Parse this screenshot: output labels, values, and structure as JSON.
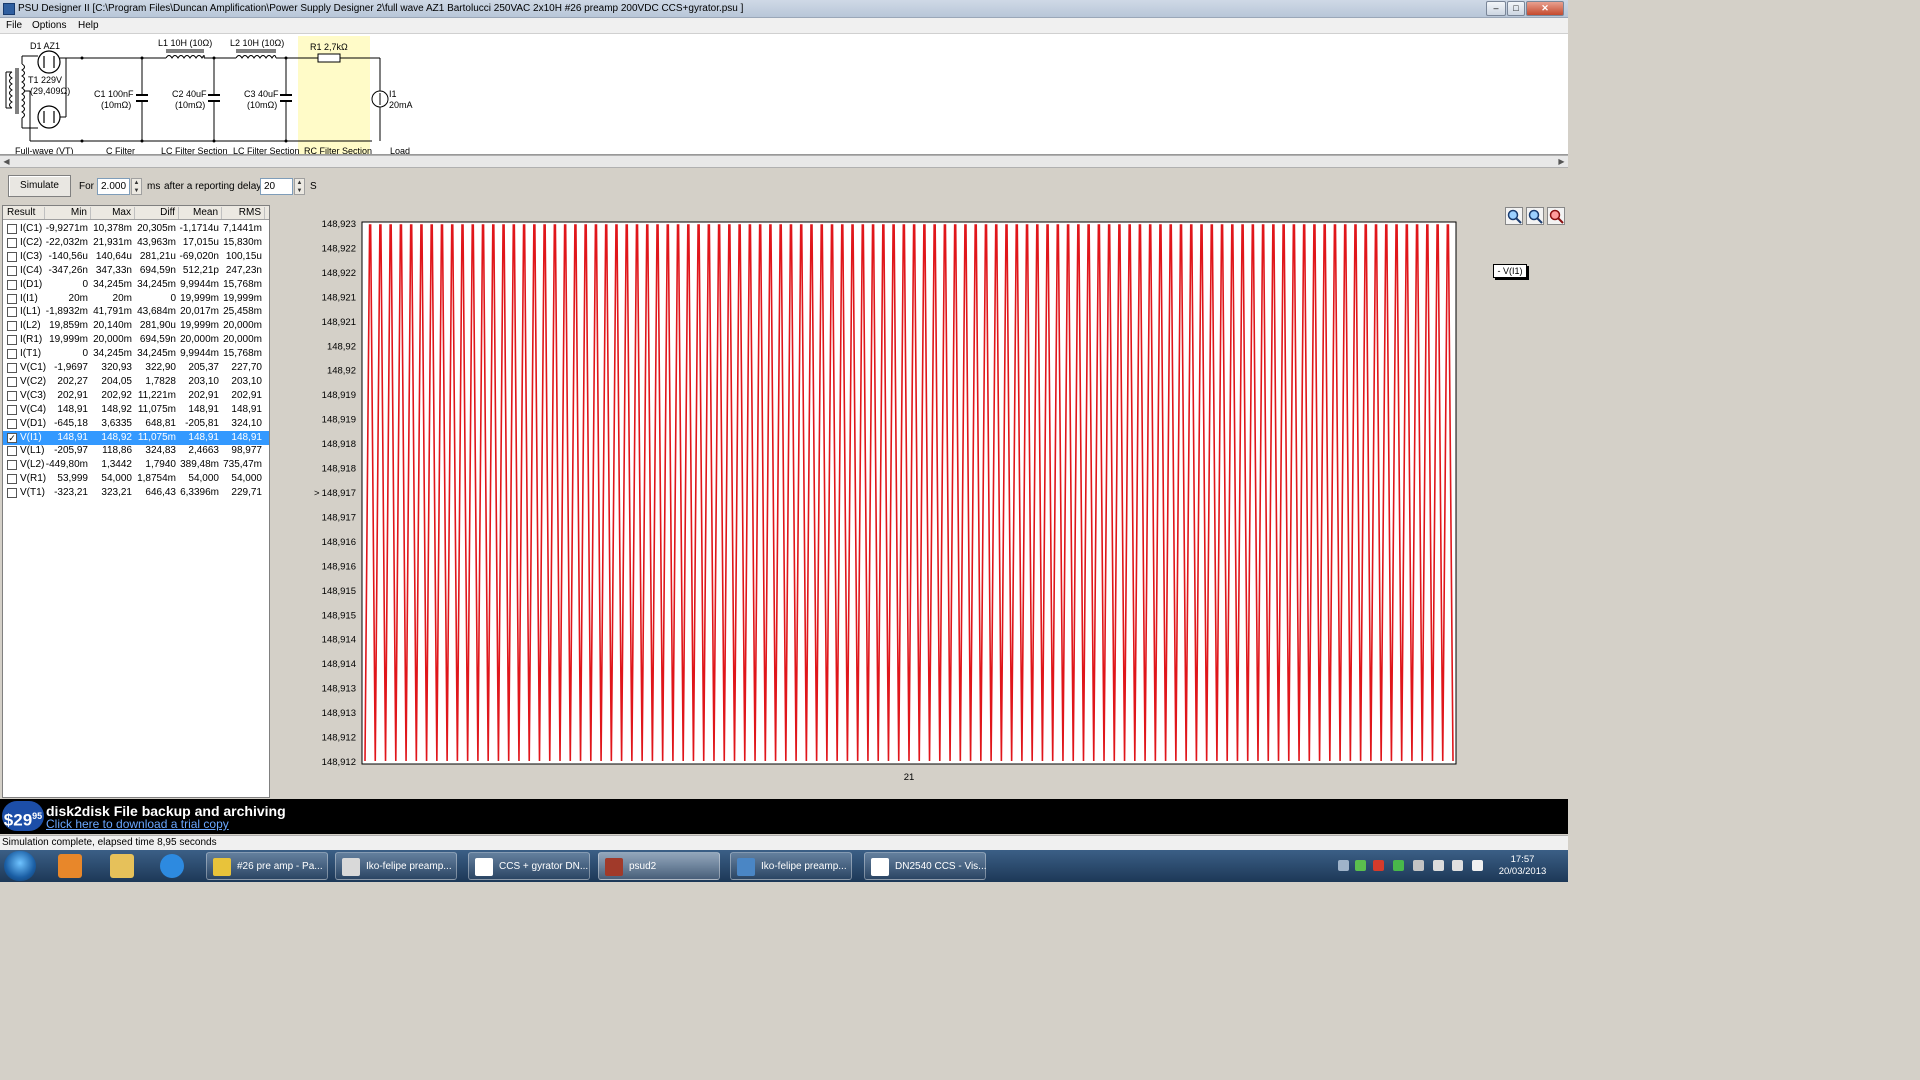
{
  "window": {
    "title": "PSU Designer II  [C:\\Program Files\\Duncan Amplification\\Power Supply Designer 2\\full wave AZ1 Bartolucci 250VAC 2x10H #26 preamp 200VDC CCS+gyrator.psu ]",
    "minimize": "–",
    "maximize": "□",
    "close": "✕"
  },
  "menu": [
    "File",
    "Options",
    "Help"
  ],
  "schematic": {
    "rectifier_label": "D1  AZ1",
    "transformer_label_1": "T1 229V",
    "transformer_label_2": "(29,409Ω)",
    "c1_label_1": "C1 100nF",
    "c1_label_2": "(10mΩ)",
    "l1_label": "L1 10H (10Ω)",
    "c2_label_1": "C2 40uF",
    "c2_label_2": "(10mΩ)",
    "l2_label": "L2 10H (10Ω)",
    "c3_label_1": "C3 40uF",
    "c3_label_2": "(10mΩ)",
    "r1_label": "R1 2,7kΩ",
    "load_label_1": "I1",
    "load_label_2": "20mA",
    "sections": [
      "Full-wave (VT)",
      "C Filter",
      "LC Filter Section",
      "LC Filter Section",
      "RC Filter Section",
      "Load"
    ]
  },
  "simulate": {
    "button": "Simulate",
    "for_label": "For",
    "duration": "2.000",
    "ms_label": "ms",
    "delay_label": "after a reporting delay of",
    "delay": "20",
    "s_label": "S"
  },
  "results": {
    "headers": [
      "Result",
      "Min",
      "Max",
      "Diff",
      "Mean",
      "RMS"
    ],
    "rows": [
      {
        "name": "I(C1)",
        "min": "-9,9271m",
        "max": "10,378m",
        "diff": "20,305m",
        "mean": "-1,1714u",
        "rms": "7,1441m",
        "checked": false
      },
      {
        "name": "I(C2)",
        "min": "-22,032m",
        "max": "21,931m",
        "diff": "43,963m",
        "mean": "17,015u",
        "rms": "15,830m",
        "checked": false
      },
      {
        "name": "I(C3)",
        "min": "-140,56u",
        "max": "140,64u",
        "diff": "281,21u",
        "mean": "-69,020n",
        "rms": "100,15u",
        "checked": false
      },
      {
        "name": "I(C4)",
        "min": "-347,26n",
        "max": "347,33n",
        "diff": "694,59n",
        "mean": "512,21p",
        "rms": "247,23n",
        "checked": false
      },
      {
        "name": "I(D1)",
        "min": "0",
        "max": "34,245m",
        "diff": "34,245m",
        "mean": "9,9944m",
        "rms": "15,768m",
        "checked": false
      },
      {
        "name": "I(I1)",
        "min": "20m",
        "max": "20m",
        "diff": "0",
        "mean": "19,999m",
        "rms": "19,999m",
        "checked": false
      },
      {
        "name": "I(L1)",
        "min": "-1,8932m",
        "max": "41,791m",
        "diff": "43,684m",
        "mean": "20,017m",
        "rms": "25,458m",
        "checked": false
      },
      {
        "name": "I(L2)",
        "min": "19,859m",
        "max": "20,140m",
        "diff": "281,90u",
        "mean": "19,999m",
        "rms": "20,000m",
        "checked": false
      },
      {
        "name": "I(R1)",
        "min": "19,999m",
        "max": "20,000m",
        "diff": "694,59n",
        "mean": "20,000m",
        "rms": "20,000m",
        "checked": false
      },
      {
        "name": "I(T1)",
        "min": "0",
        "max": "34,245m",
        "diff": "34,245m",
        "mean": "9,9944m",
        "rms": "15,768m",
        "checked": false
      },
      {
        "name": "V(C1)",
        "min": "-1,9697",
        "max": "320,93",
        "diff": "322,90",
        "mean": "205,37",
        "rms": "227,70",
        "checked": false
      },
      {
        "name": "V(C2)",
        "min": "202,27",
        "max": "204,05",
        "diff": "1,7828",
        "mean": "203,10",
        "rms": "203,10",
        "checked": false
      },
      {
        "name": "V(C3)",
        "min": "202,91",
        "max": "202,92",
        "diff": "11,221m",
        "mean": "202,91",
        "rms": "202,91",
        "checked": false
      },
      {
        "name": "V(C4)",
        "min": "148,91",
        "max": "148,92",
        "diff": "11,075m",
        "mean": "148,91",
        "rms": "148,91",
        "checked": false
      },
      {
        "name": "V(D1)",
        "min": "-645,18",
        "max": "3,6335",
        "diff": "648,81",
        "mean": "-205,81",
        "rms": "324,10",
        "checked": false
      },
      {
        "name": "V(I1)",
        "min": "148,91",
        "max": "148,92",
        "diff": "11,075m",
        "mean": "148,91",
        "rms": "148,91",
        "checked": true
      },
      {
        "name": "V(L1)",
        "min": "-205,97",
        "max": "118,86",
        "diff": "324,83",
        "mean": "2,4663",
        "rms": "98,977",
        "checked": false
      },
      {
        "name": "V(L2)",
        "min": "-449,80m",
        "max": "1,3442",
        "diff": "1,7940",
        "mean": "389,48m",
        "rms": "735,47m",
        "checked": false
      },
      {
        "name": "V(R1)",
        "min": "53,999",
        "max": "54,000",
        "diff": "1,8754m",
        "mean": "54,000",
        "rms": "54,000",
        "checked": false
      },
      {
        "name": "V(T1)",
        "min": "-323,21",
        "max": "323,21",
        "diff": "646,43",
        "mean": "6,3396m",
        "rms": "229,71",
        "checked": false
      }
    ],
    "selected_index": 15
  },
  "colors": {
    "trace": "#e0161b",
    "plot_bg": "#ffffff",
    "selection": "#3399ff"
  },
  "chart_data": {
    "type": "line",
    "series": [
      {
        "name": "V(I1)",
        "color": "#e0161b",
        "min": 148.912,
        "max": 148.923,
        "shape": "dense periodic ripple"
      }
    ],
    "y_tick_labels": [
      "148,923",
      "148,922",
      "148,922",
      "148,921",
      "148,921",
      "148,92",
      "148,92",
      "148,919",
      "148,919",
      "148,918",
      "148,918",
      "148,917",
      "148,917",
      "148,916",
      "148,916",
      "148,915",
      "148,915",
      "148,914",
      "148,914",
      "148,913",
      "148,913",
      "148,912",
      "148,912"
    ],
    "y_marker": ">",
    "x_tick_labels": [
      "21"
    ],
    "ylim": [
      148.912,
      148.923
    ],
    "cycles": 106,
    "legend": "- V(I1)",
    "legend_position": "right"
  },
  "ad": {
    "price": "$29",
    "price_cents": "95",
    "headline": "disk2disk File backup and archiving",
    "link": "Click here to download a trial copy"
  },
  "status": "Simulation complete, elapsed time 8,95 seconds",
  "taskbar": {
    "tasks": [
      {
        "label": "#26 pre amp - Pa...",
        "icon": "chrome-icon",
        "active": false
      },
      {
        "label": "Iko-felipe preamp...",
        "icon": "paint-icon",
        "active": false
      },
      {
        "label": "CCS + gyrator DN...",
        "icon": "word-icon",
        "active": false
      },
      {
        "label": "psud2",
        "icon": "psud-icon",
        "active": true
      },
      {
        "label": "Iko-felipe preamp...",
        "icon": "image-viewer-icon",
        "active": false
      },
      {
        "label": "DN2540 CCS - Vis...",
        "icon": "visio-icon",
        "active": false
      }
    ],
    "time": "17:57",
    "date": "20/03/2013"
  }
}
